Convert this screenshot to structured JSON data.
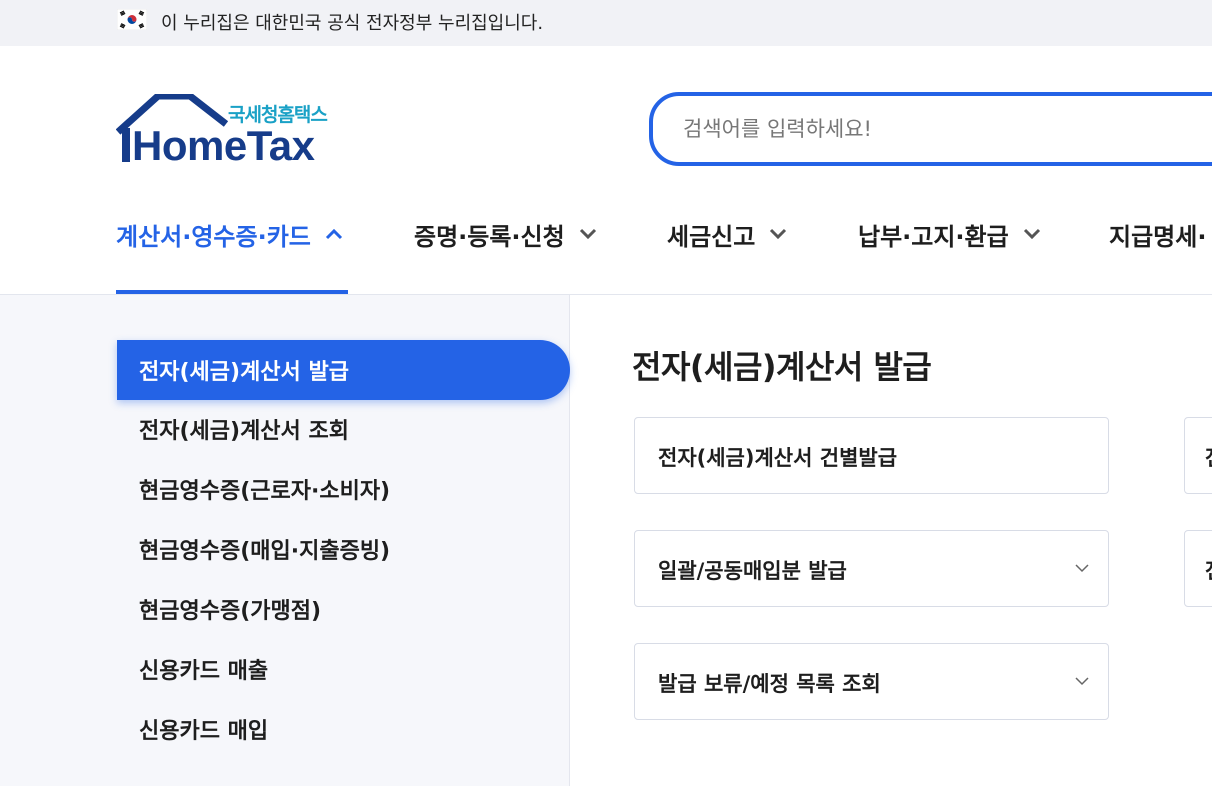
{
  "gov_banner": {
    "flag_icon": "korean-flag-icon",
    "text": "이 누리집은 대한민국 공식 전자정부 누리집입니다."
  },
  "logo": {
    "subtitle": "국세청홈택스",
    "title": "HomeTax",
    "brand_color": "#163c8a",
    "accent_color": "#1aa1c6"
  },
  "search": {
    "placeholder": "검색어를 입력하세요!",
    "value": ""
  },
  "gnb": {
    "items": [
      {
        "label": "계산서·영수증·카드",
        "state": "expanded",
        "icon": "chevron-up-icon"
      },
      {
        "label": "증명·등록·신청",
        "state": "collapsed",
        "icon": "chevron-down-icon"
      },
      {
        "label": "세금신고",
        "state": "collapsed",
        "icon": "chevron-down-icon"
      },
      {
        "label": "납부·고지·환급",
        "state": "collapsed",
        "icon": "chevron-down-icon"
      },
      {
        "label": "지급명세·",
        "state": "collapsed"
      }
    ],
    "active_color": "#2463e6"
  },
  "lnb": {
    "items": [
      {
        "label": "전자(세금)계산서 발급",
        "active": true
      },
      {
        "label": "전자(세금)계산서 조회",
        "active": false
      },
      {
        "label": "현금영수증(근로자·소비자)",
        "active": false
      },
      {
        "label": "현금영수증(매입·지출증빙)",
        "active": false
      },
      {
        "label": "현금영수증(가맹점)",
        "active": false
      },
      {
        "label": "신용카드 매출",
        "active": false
      },
      {
        "label": "신용카드 매입",
        "active": false
      }
    ]
  },
  "content": {
    "title": "전자(세금)계산서 발급",
    "cards": [
      {
        "label": "전자(세금)계산서 건별발급",
        "has_dropdown": false
      },
      {
        "label": "일괄/공동매입분 발급",
        "has_dropdown": true,
        "icon": "chevron-down-icon"
      },
      {
        "label": "발급 보류/예정 목록 조회",
        "has_dropdown": true,
        "icon": "chevron-down-icon"
      }
    ],
    "right_cards": [
      {
        "label": "전"
      },
      {
        "label": "전"
      }
    ]
  }
}
